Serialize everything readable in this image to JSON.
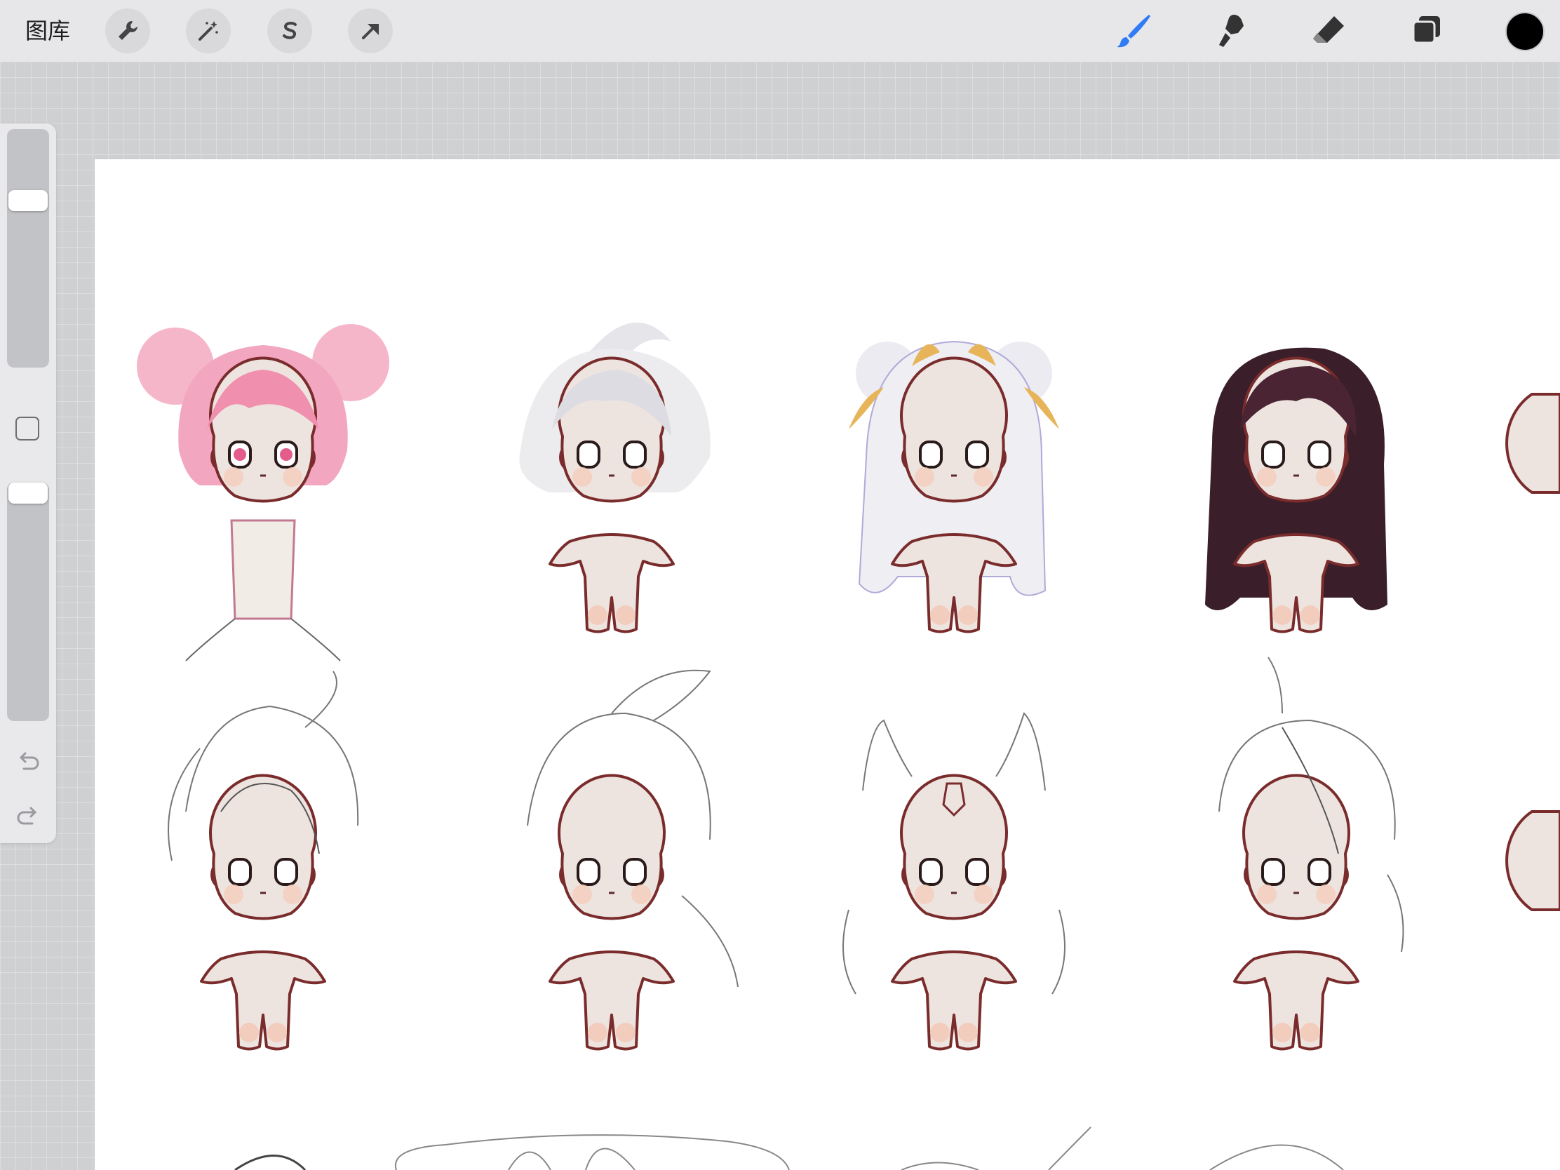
{
  "toolbar": {
    "gallery_label": "图库",
    "left_tools": [
      {
        "name": "actions",
        "icon": "wrench-icon"
      },
      {
        "name": "adjustments",
        "icon": "magic-wand-icon"
      },
      {
        "name": "selection",
        "icon": "selection-s-icon"
      },
      {
        "name": "transform",
        "icon": "arrow-cursor-icon"
      }
    ],
    "right_tools": [
      {
        "name": "brush",
        "icon": "brush-icon",
        "active": true
      },
      {
        "name": "smudge",
        "icon": "smudge-icon",
        "active": false
      },
      {
        "name": "eraser",
        "icon": "eraser-icon",
        "active": false
      },
      {
        "name": "layers",
        "icon": "layers-icon",
        "active": false
      }
    ],
    "current_color": "#000000",
    "accent_color": "#2f7cf6"
  },
  "sidebar": {
    "brush_size_level": 0.72,
    "opacity_level": 1.0,
    "icons": [
      "modify-square-icon",
      "undo-icon",
      "redo-icon"
    ]
  },
  "canvas": {
    "background": "#ffffff",
    "characters": [
      {
        "row": 1,
        "col": 1,
        "state": "colored",
        "hair_color": "#f2a6bf"
      },
      {
        "row": 1,
        "col": 2,
        "state": "colored",
        "hair_color": "#e8e8ea"
      },
      {
        "row": 1,
        "col": 3,
        "state": "colored",
        "hair_color": "#ecebf2",
        "accent": "#e7b45a"
      },
      {
        "row": 1,
        "col": 4,
        "state": "colored",
        "hair_color": "#3a1e2a"
      },
      {
        "row": 2,
        "col": 1,
        "state": "sketch"
      },
      {
        "row": 2,
        "col": 2,
        "state": "sketch"
      },
      {
        "row": 2,
        "col": 3,
        "state": "sketch"
      },
      {
        "row": 2,
        "col": 4,
        "state": "sketch"
      }
    ]
  }
}
